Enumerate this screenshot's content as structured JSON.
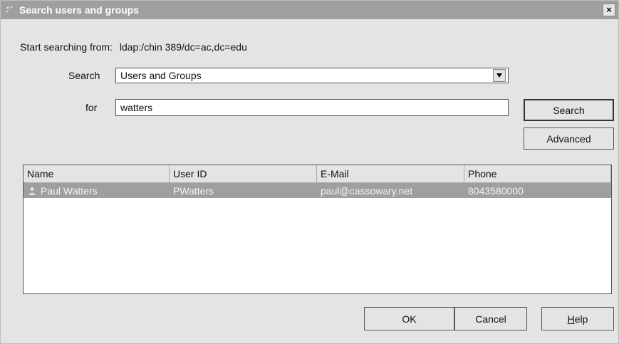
{
  "window": {
    "title": "Search users and groups",
    "close_glyph": "×"
  },
  "start": {
    "label": "Start searching from:",
    "path": "ldap:/chin 389/dc=ac,dc=edu"
  },
  "search": {
    "label": "Search",
    "value": "Users and Groups"
  },
  "for": {
    "label": "for",
    "value": "watters"
  },
  "buttons": {
    "search": "Search",
    "advanced": "Advanced",
    "ok": "OK",
    "cancel": "Cancel",
    "help_first": "H",
    "help_rest": "elp"
  },
  "table": {
    "columns": [
      "Name",
      "User ID",
      "E-Mail",
      "Phone"
    ],
    "rows": [
      {
        "name": "Paul Watters",
        "user_id": "PWatters",
        "email": "paul@cassowary.net",
        "phone": "8043580000",
        "icon": "user-icon"
      }
    ]
  },
  "colors": {
    "titlebar": "#9f9f9f",
    "selection": "#9f9f9f",
    "background": "#e4e4e4"
  }
}
